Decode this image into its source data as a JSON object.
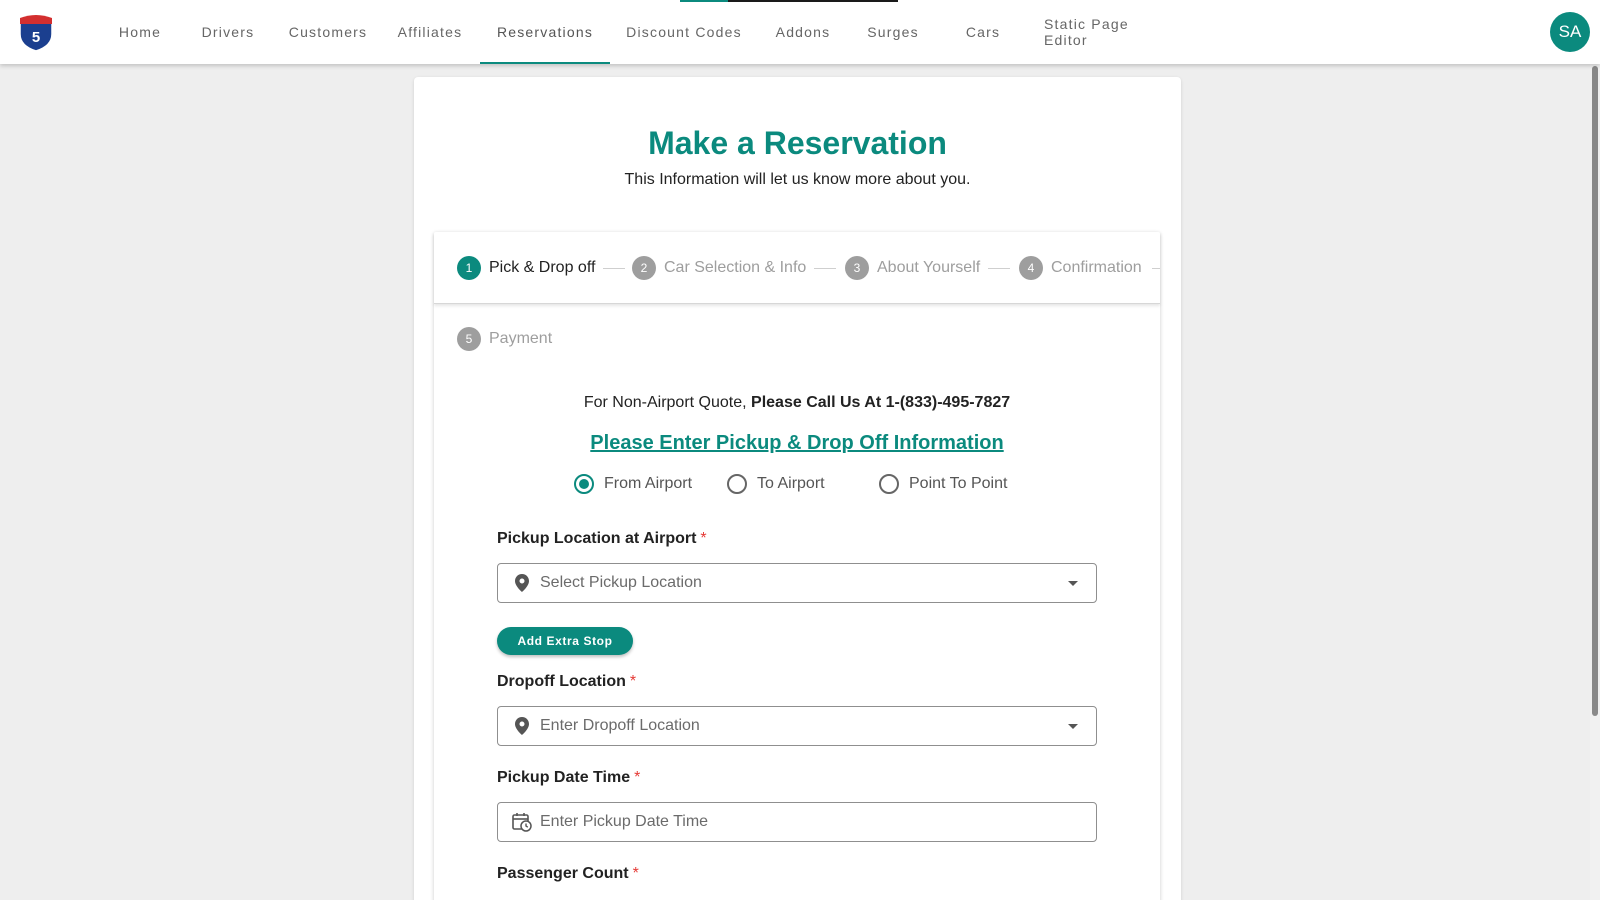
{
  "nav": {
    "items": [
      "Home",
      "Drivers",
      "Customers",
      "Affiliates",
      "Reservations",
      "Discount Codes",
      "Addons",
      "Surges",
      "Cars",
      "Static Page Editor"
    ],
    "active_index": 4,
    "avatar_initials": "SA",
    "logo_number": "5"
  },
  "page": {
    "title": "Make a Reservation",
    "subtitle": "This Information will let us know more about you."
  },
  "stepper": {
    "steps": [
      {
        "number": "1",
        "label": "Pick & Drop off"
      },
      {
        "number": "2",
        "label": "Car Selection & Info"
      },
      {
        "number": "3",
        "label": "About Yourself"
      },
      {
        "number": "4",
        "label": "Confirmation"
      },
      {
        "number": "5",
        "label": "Payment"
      }
    ],
    "active_step": 1
  },
  "form": {
    "notice_prefix": "For Non-Airport Quote,",
    "notice_bold": "Please Call Us At 1-(833)-495-7827",
    "section_heading": "Please Enter Pickup & Drop Off Information",
    "trip_types": [
      "From Airport",
      "To Airport",
      "Point To Point"
    ],
    "selected_trip_type": "From Airport",
    "pickup_label": "Pickup Location at Airport",
    "pickup_placeholder": "Select Pickup Location",
    "extra_stop_button": "Add Extra Stop",
    "dropoff_label": "Dropoff Location",
    "dropoff_placeholder": "Enter Dropoff Location",
    "datetime_label": "Pickup Date Time",
    "datetime_placeholder": "Enter Pickup Date Time",
    "passenger_label": "Passenger Count",
    "required_mark": "*"
  },
  "colors": {
    "accent": "#0b8a7e",
    "required": "#e53935",
    "inactive_step": "#9e9e9e"
  }
}
